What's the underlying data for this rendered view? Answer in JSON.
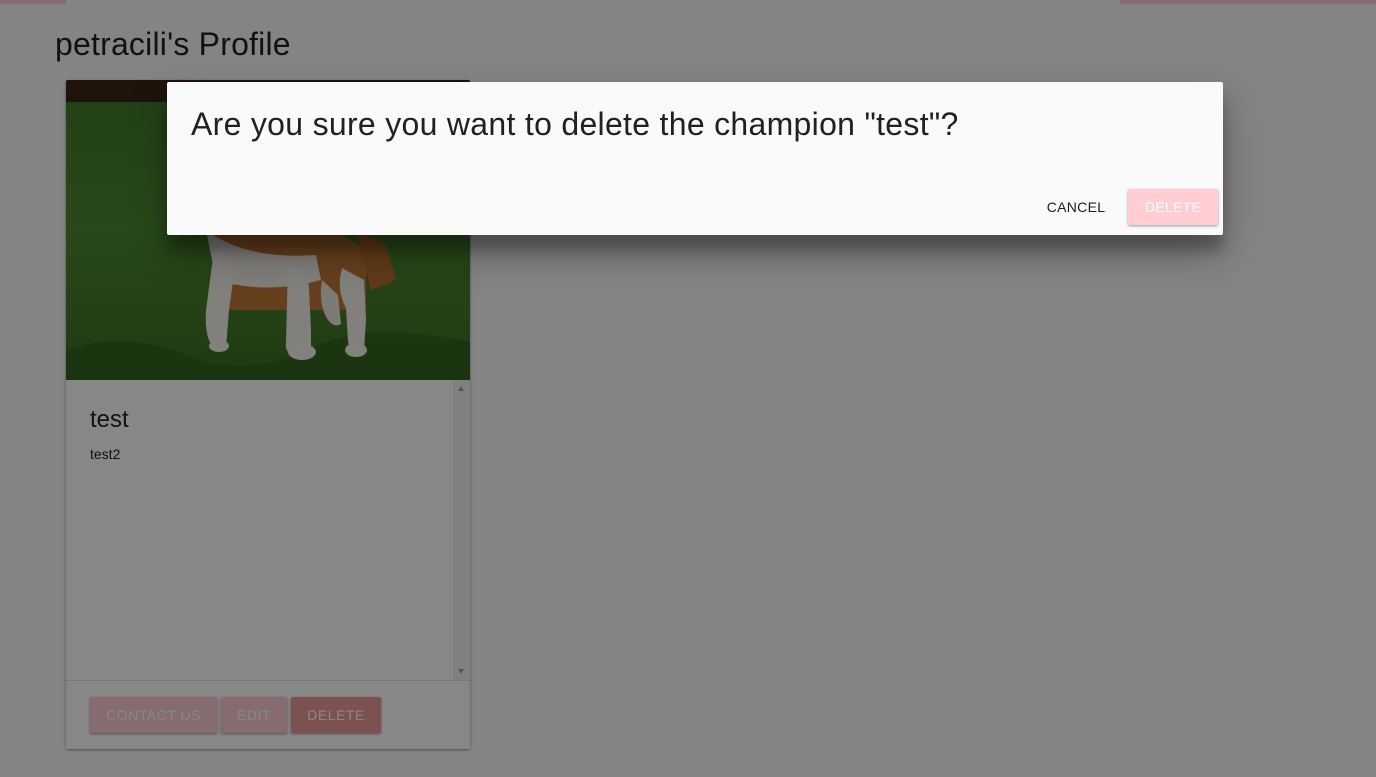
{
  "page": {
    "title": "petracili's Profile"
  },
  "champion_card": {
    "image_icon": "bulldog-photo",
    "name": "test",
    "description": "test2",
    "actions": {
      "contact_label": "CONTACT US",
      "edit_label": "EDIT",
      "delete_label": "DELETE"
    }
  },
  "dialog": {
    "title": "Are you sure you want to delete the champion \"test\"?",
    "cancel_label": "CANCEL",
    "delete_label": "DELETE"
  },
  "colors": {
    "accent_light": "#ffcdd2",
    "accent": "#ef9a9a",
    "overlay": "rgba(0,0,0,0.47)"
  }
}
